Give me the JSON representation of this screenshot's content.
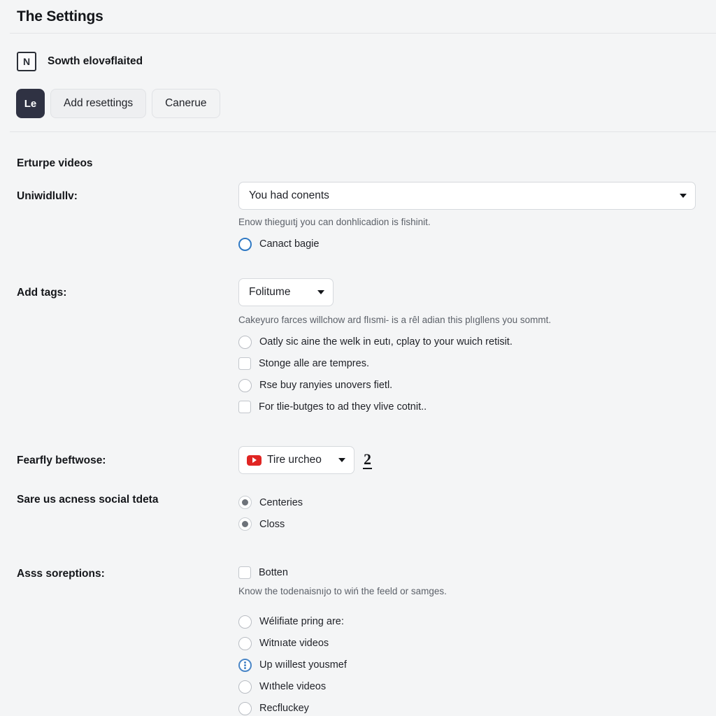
{
  "header": {
    "title": "The Settings"
  },
  "account": {
    "icon": "n-square-icon",
    "name": "Sowth elovәflaited"
  },
  "toolbar": {
    "badge_label": "Le",
    "primary_label": "Add resettings",
    "secondary_label": "Canerue"
  },
  "sections": {
    "feature_heading": "Erturpe videos"
  },
  "fields": {
    "individually": {
      "label": "Uniwidlullv:",
      "select_value": "You had conents",
      "helper": "Enow thieguıtj you can donhlicadion is fishinit.",
      "option": {
        "label": "Canact bagie",
        "type": "radio",
        "state": "blue-empty"
      }
    },
    "add_tags": {
      "label": "Add tags:",
      "select_value": "Folitume",
      "helper": "Cakeyuro farces willchow ard flısmi- is a rêl adian this plıgllens you sommt.",
      "options": [
        {
          "label": "Oatly sic aine the welk in eutı, cplay to your wuich retisit.",
          "type": "radio",
          "state": "empty"
        },
        {
          "label": "Stonge alle are tempres.",
          "type": "checkbox",
          "state": "empty"
        },
        {
          "label": "Rse buy ranyies unovers fietl.",
          "type": "radio",
          "state": "empty"
        },
        {
          "label": "For tlie-butges to ad they vlive cotnit..",
          "type": "checkbox",
          "state": "empty"
        }
      ]
    },
    "fearfly": {
      "label": "Fearfly beftwose:",
      "select_value": "Tire urcheo",
      "select_icon": "youtube-icon",
      "count": "2"
    },
    "social": {
      "label": "Sare us acness social tdeta",
      "options": [
        {
          "label": "Centeries",
          "type": "radio",
          "state": "checked"
        },
        {
          "label": "Closs",
          "type": "radio",
          "state": "checked"
        }
      ]
    },
    "ass_soreptions": {
      "label": "Asss soreptions:",
      "checkbox": {
        "label": "Botten",
        "type": "checkbox",
        "state": "empty"
      },
      "helper": "Know the todenaisnıjo to wiń the feeld or samges.",
      "options": [
        {
          "label": "Wélifiate pring are:",
          "type": "radio",
          "state": "empty"
        },
        {
          "label": "Witnıate videos",
          "type": "radio",
          "state": "empty"
        },
        {
          "label": "Up wıillest yousmef",
          "type": "radio",
          "state": "blue-dot"
        },
        {
          "label": "Wıthele videos",
          "type": "radio",
          "state": "empty"
        },
        {
          "label": "Recfluckey",
          "type": "radio",
          "state": "empty"
        }
      ]
    }
  },
  "colors": {
    "background": "#f4f5f6",
    "accent_dark": "#2f3243",
    "accent_blue": "#2f79c4",
    "youtube_red": "#e02523",
    "divider": "#e2e4e7"
  }
}
